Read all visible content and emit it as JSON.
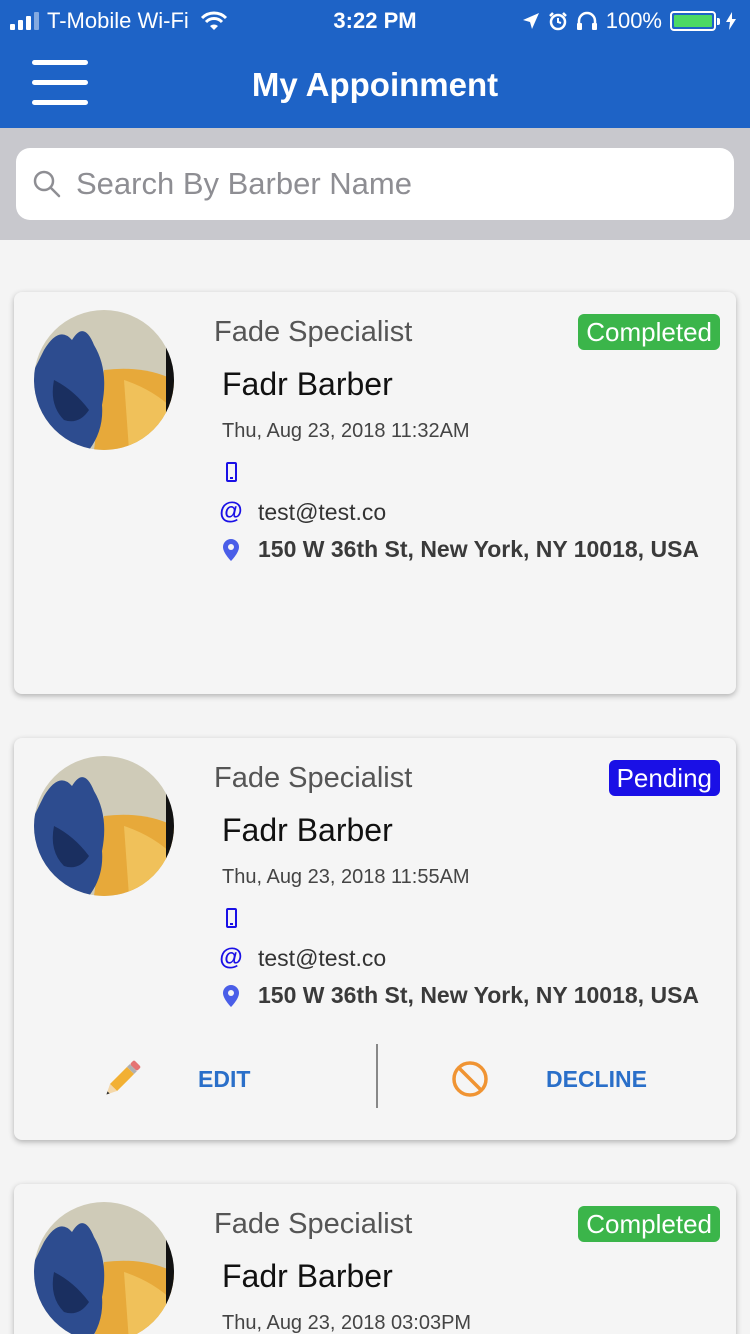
{
  "status_bar": {
    "carrier": "T-Mobile Wi-Fi",
    "time": "3:22 PM",
    "battery": "100%"
  },
  "nav": {
    "title": "My Appoinment"
  },
  "search": {
    "placeholder": "Search By Barber Name",
    "value": ""
  },
  "colors": {
    "nav_blue": "#1e63c6",
    "completed_green": "#3bb54a",
    "pending_blue": "#1a10e6",
    "action_blue": "#2a6fc9"
  },
  "appointments": [
    {
      "specialty": "Fade Specialist",
      "status": "Completed",
      "barber": "Fadr Barber",
      "datetime": "Thu, Aug 23, 2018 11:32AM",
      "phone": "",
      "email": "test@test.co",
      "address": "150 W 36th St, New York, NY 10018, USA"
    },
    {
      "specialty": "Fade Specialist",
      "status": "Pending",
      "barber": "Fadr Barber",
      "datetime": "Thu, Aug 23, 2018 11:55AM",
      "phone": "",
      "email": "test@test.co",
      "address": "150 W 36th St, New York, NY 10018, USA",
      "actions": {
        "edit_label": "EDIT",
        "decline_label": "DECLINE"
      }
    },
    {
      "specialty": "Fade Specialist",
      "status": "Completed",
      "barber": "Fadr Barber",
      "datetime": "Thu, Aug 23, 2018 03:03PM"
    }
  ]
}
